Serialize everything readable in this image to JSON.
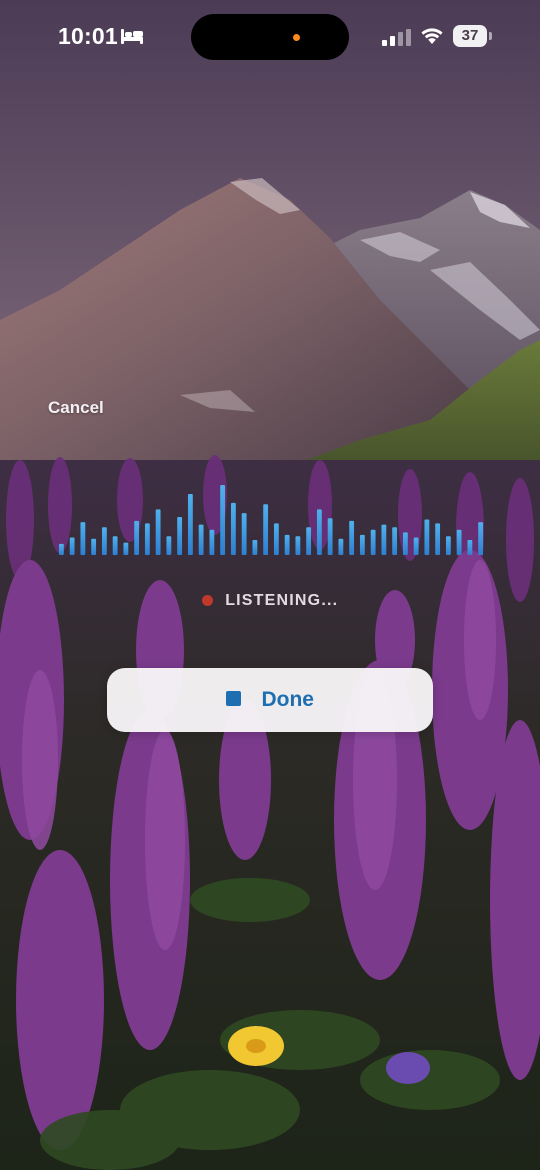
{
  "status_bar": {
    "time": "10:01",
    "battery_level": "37",
    "sleep_icon": "bed-icon",
    "signal_icon": "cellular-signal-icon",
    "wifi_icon": "wifi-icon"
  },
  "dictation": {
    "cancel_label": "Cancel",
    "listening_label": "LISTENING...",
    "done_label": "Done",
    "waveform_levels": [
      0.08,
      0.18,
      0.42,
      0.16,
      0.34,
      0.2,
      0.1,
      0.44,
      0.4,
      0.62,
      0.2,
      0.5,
      0.86,
      0.38,
      0.3,
      1.0,
      0.72,
      0.56,
      0.14,
      0.7,
      0.4,
      0.22,
      0.2,
      0.34,
      0.62,
      0.48,
      0.16,
      0.44,
      0.22,
      0.3,
      0.38,
      0.34,
      0.26,
      0.18,
      0.46,
      0.4,
      0.2,
      0.3,
      0.14,
      0.42
    ]
  },
  "colors": {
    "waveform_top": "#4fb1ec",
    "waveform_bottom": "#2f7fd0",
    "recording_dot": "#c0392b",
    "done_text": "#1e6fb2",
    "stop_icon": "#1e6fb2",
    "mic_indicator": "#ff8a1c"
  }
}
